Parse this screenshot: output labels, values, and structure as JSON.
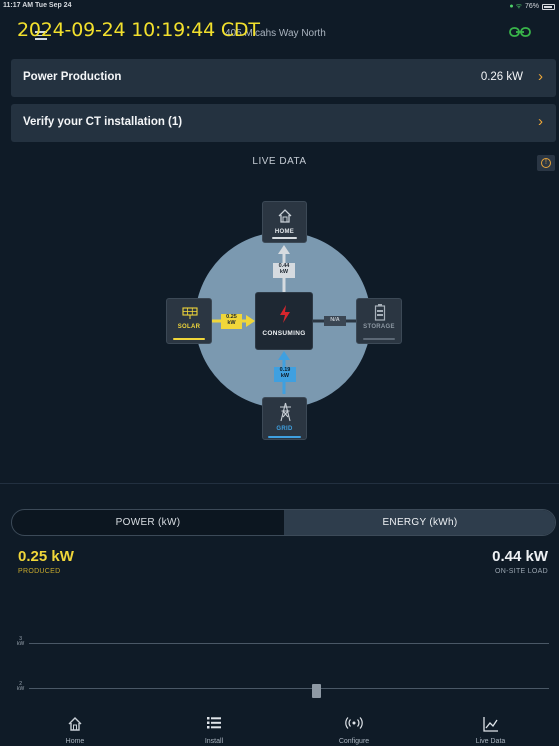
{
  "status_bar": {
    "time": "11:17 AM  Tue Sep 24",
    "battery": "76%"
  },
  "timestamp_overlay": "2024-09-24 10:19:44 CDT",
  "header": {
    "address": "405 Micahs Way North",
    "menu_icon": "hamburger-menu-icon",
    "link_icon": "link-icon"
  },
  "cards": [
    {
      "label": "Power Production",
      "value": "0.26 kW"
    },
    {
      "label": "Verify your CT installation (1)",
      "value": ""
    }
  ],
  "live_data": {
    "title": "LIVE DATA",
    "nodes": {
      "home": "HOME",
      "solar": "SOLAR",
      "center": "CONSUMING",
      "storage": "STORAGE",
      "grid": "GRID"
    },
    "edges": {
      "home_value": "0.44",
      "home_unit": "kW",
      "solar_value": "0.25",
      "solar_unit": "kW",
      "storage_value": "N/A",
      "grid_value": "0.19",
      "grid_unit": "kW"
    }
  },
  "toggle": {
    "left": "POWER (kW)",
    "right": "ENERGY (kWh)",
    "selected": "ENERGY (kWh)"
  },
  "summary": {
    "produced_value": "0.25 kW",
    "produced_caption": "PRODUCED",
    "load_value": "0.44 kW",
    "load_caption": "ON-SITE LOAD"
  },
  "chart_data": {
    "type": "bar",
    "y_ticks": [
      {
        "value": "3",
        "unit": "kW"
      },
      {
        "value": "2",
        "unit": "kW"
      }
    ]
  },
  "tabs": [
    {
      "label": "Home",
      "icon": "home-icon"
    },
    {
      "label": "Install",
      "icon": "list-icon"
    },
    {
      "label": "Configure",
      "icon": "broadcast-icon"
    },
    {
      "label": "Live Data",
      "icon": "line-chart-icon",
      "active": true
    }
  ],
  "colors": {
    "accent": "#f0a838",
    "solar": "#f0d63a",
    "grid": "#3fa0e0",
    "background": "#0f1b27"
  }
}
